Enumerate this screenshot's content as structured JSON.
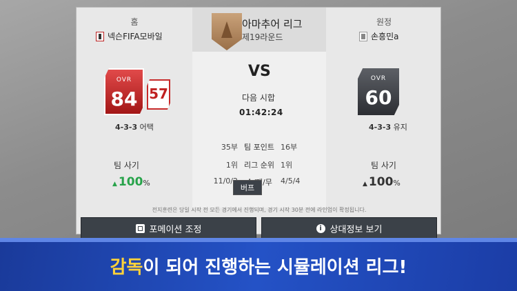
{
  "home": {
    "side_label": "홈",
    "team_name": "넥슨FIFA모바일",
    "ovr_label": "OVR",
    "ovr": 84,
    "secondary_rating": 57,
    "formation_num": "4-3-3",
    "formation_style": "어택",
    "morale_label": "팀 사기",
    "morale_value": "100",
    "morale_unit": "%",
    "buff_button": "버프",
    "crest_icon": "tottenham-crest-icon"
  },
  "away": {
    "side_label": "원정",
    "team_name": "손흥민a",
    "ovr_label": "OVR",
    "ovr": 60,
    "formation_num": "4-3-3",
    "formation_style": "유지",
    "morale_label": "팀 사기",
    "morale_value": "100",
    "morale_unit": "%",
    "crest_icon": "real-madrid-crest-icon"
  },
  "league": {
    "title": "아마추어 리그",
    "round": "제19라운드",
    "badge_icon": "amateur-league-badge-icon"
  },
  "match": {
    "vs": "VS",
    "next_label": "다음 시합",
    "timer": "01:42:24"
  },
  "stats": [
    {
      "home": "35부",
      "label": "팀 포인트",
      "away": "16부"
    },
    {
      "home": "1위",
      "label": "리그 순위",
      "away": "1위"
    },
    {
      "home": "11/0/2",
      "label": "승/패/무",
      "away": "4/5/4"
    }
  ],
  "notice": "전지훈련은 당일 시작 전 모든 경기에서 진행되며, 경기 시작 30분 전에 라인업이 확정됩니다.",
  "buttons": {
    "formation": "포메이션 조정",
    "opponent": "상대정보 보기"
  },
  "banner": {
    "highlight": "감독",
    "rest": "이 되어 진행하는 시뮬레이션 리그!"
  },
  "colors": {
    "home_card": "#c72a2a",
    "away_card": "#3a3d42",
    "morale_up": "#27a34a",
    "banner_bg": "#2452c6",
    "banner_highlight": "#ffd23a"
  }
}
